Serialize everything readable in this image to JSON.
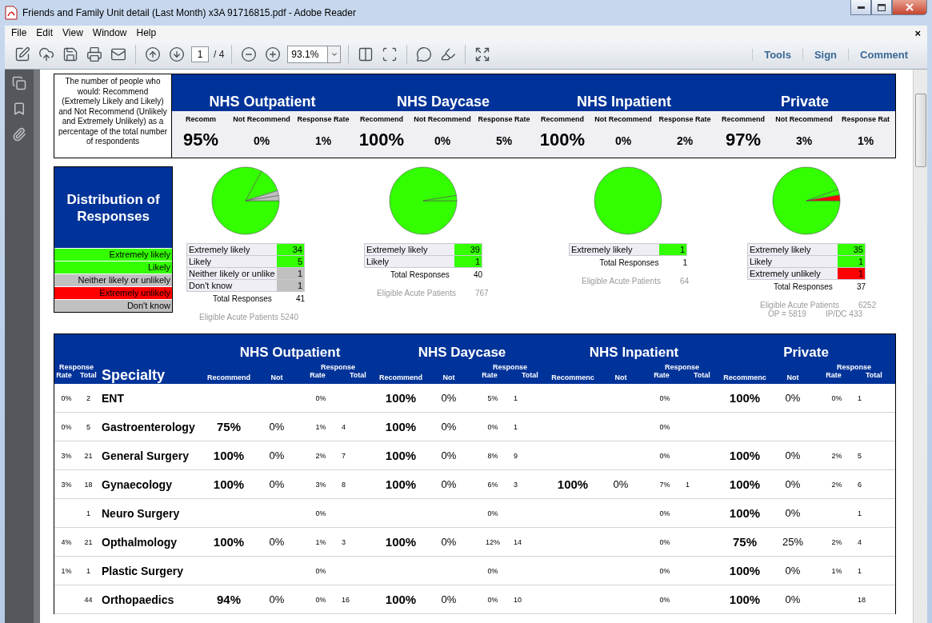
{
  "window": {
    "title": "Friends and Family Unit detail (Last Month) x3A 91716815.pdf - Adobe Reader"
  },
  "menu": [
    "File",
    "Edit",
    "View",
    "Window",
    "Help"
  ],
  "menu_close": "×",
  "toolbar": {
    "page": "1",
    "page_count": "/ 4",
    "zoom": "93.1%",
    "links": [
      "Tools",
      "Sign",
      "Comment"
    ]
  },
  "summary": {
    "description": "The number of people who would: Recommend (Extremely Likely and Likely) and Not Recommend (Unlikely and Extremely Unlikely) as a percentage of the total number of respondents",
    "sections": [
      {
        "title": "NHS Outpatient",
        "headers": [
          "Recomm",
          "Not Recommend",
          "Response Rate"
        ],
        "values": [
          "95%",
          "0%",
          "1%"
        ]
      },
      {
        "title": "NHS Daycase",
        "headers": [
          "Recommend",
          "Not Recommend",
          "Response Rate"
        ],
        "values": [
          "100%",
          "0%",
          "5%"
        ]
      },
      {
        "title": "NHS Inpatient",
        "headers": [
          "Recommend",
          "Not Recommend",
          "Response Rate"
        ],
        "values": [
          "100%",
          "0%",
          "2%"
        ]
      },
      {
        "title": "Private",
        "headers": [
          "Recommend",
          "Not Recommend",
          "Response Rat"
        ],
        "values": [
          "97%",
          "3%",
          "1%"
        ]
      }
    ]
  },
  "distribution": {
    "title": "Distribution of Responses",
    "legend": [
      {
        "label": "Extremely likely",
        "color": "#33ff00"
      },
      {
        "label": "Likely",
        "color": "#33ff00"
      },
      {
        "label": "Neither likely or unlikely",
        "color": "#c0c0c0"
      },
      {
        "label": "Extremely unlikely",
        "color": "#ff0000"
      },
      {
        "label": "Don't know",
        "color": "#c0c0c0"
      }
    ],
    "panels": [
      {
        "rows": [
          {
            "label": "Extremely likely",
            "count": "34",
            "color": "#33ff00"
          },
          {
            "label": "Likely",
            "count": "5",
            "color": "#33ff00"
          },
          {
            "label": "Neither likely or unlike",
            "count": "1",
            "color": "#c0c0c0"
          },
          {
            "label": "Don't know",
            "count": "1",
            "color": "#c0c0c0"
          }
        ],
        "total_label": "Total Responses",
        "total": "41",
        "eligible": [
          [
            "Eligible Acute Patients 5240"
          ]
        ]
      },
      {
        "rows": [
          {
            "label": "Extremely likely",
            "count": "39",
            "color": "#33ff00"
          },
          {
            "label": "Likely",
            "count": "1",
            "color": "#33ff00"
          }
        ],
        "total_label": "Total Responses",
        "total": "40",
        "eligible": [
          [
            "Eligible Acute Patients",
            "767"
          ]
        ]
      },
      {
        "rows": [
          {
            "label": "Extremely likely",
            "count": "1",
            "color": "#33ff00"
          }
        ],
        "total_label": "Total Responses",
        "total": "1",
        "eligible": [
          [
            "Eligible Acute Patients",
            "64"
          ]
        ]
      },
      {
        "rows": [
          {
            "label": "Extremely likely",
            "count": "35",
            "color": "#33ff00"
          },
          {
            "label": "Likely",
            "count": "1",
            "color": "#33ff00"
          },
          {
            "label": "Extremely unlikely",
            "count": "1",
            "color": "#ff0000"
          }
        ],
        "total_label": "Total Responses",
        "total": "37",
        "eligible": [
          [
            "Eligible Acute Patients",
            "6252"
          ],
          [
            "OP = 5819",
            "IP/DC 433"
          ]
        ]
      }
    ]
  },
  "table": {
    "left_headers": {
      "response": "Response",
      "rate": "Rate",
      "total": "Total",
      "specialty": "Specialty"
    },
    "sections": [
      {
        "title": "NHS Outpatient",
        "recommend": "Recommend",
        "not": "Not",
        "response": "Response",
        "rate": "Rate",
        "total": "Total"
      },
      {
        "title": "NHS Daycase",
        "recommend": "Recommend",
        "not": "Not",
        "response": "Response",
        "rate": "Rate",
        "total": "Total"
      },
      {
        "title": "NHS Inpatient",
        "recommend": "Recommenc",
        "not": "Not",
        "response": "Response",
        "rate": "Rate",
        "total": "Total"
      },
      {
        "title": "Private",
        "recommend": "Recommenc",
        "not": "Not",
        "response": "Response",
        "rate": "Rate",
        "total": "Total"
      }
    ],
    "rows": [
      {
        "rate": "0%",
        "total": "2",
        "specialty": "ENT",
        "cells": [
          {
            "rate": "0%"
          },
          {
            "recommend": "100%",
            "not": "0%",
            "rate": "5%",
            "total": "1"
          },
          {
            "rate": "0%"
          },
          {
            "recommend": "100%",
            "not": "0%",
            "rate": "0%",
            "total": "1"
          }
        ]
      },
      {
        "rate": "0%",
        "total": "5",
        "specialty": "Gastroenterology",
        "cells": [
          {
            "recommend": "75%",
            "not": "0%",
            "rate": "1%",
            "total": "4"
          },
          {
            "recommend": "100%",
            "not": "0%",
            "rate": "0%",
            "total": "1"
          },
          {
            "rate": "0%"
          },
          {}
        ]
      },
      {
        "rate": "3%",
        "total": "21",
        "specialty": "General Surgery",
        "cells": [
          {
            "recommend": "100%",
            "not": "0%",
            "rate": "2%",
            "total": "7"
          },
          {
            "recommend": "100%",
            "not": "0%",
            "rate": "8%",
            "total": "9"
          },
          {
            "rate": "0%"
          },
          {
            "recommend": "100%",
            "not": "0%",
            "rate": "2%",
            "total": "5"
          }
        ]
      },
      {
        "rate": "3%",
        "total": "18",
        "specialty": "Gynaecology",
        "cells": [
          {
            "recommend": "100%",
            "not": "0%",
            "rate": "3%",
            "total": "8"
          },
          {
            "recommend": "100%",
            "not": "0%",
            "rate": "6%",
            "total": "3"
          },
          {
            "recommend": "100%",
            "not": "0%",
            "rate": "7%",
            "total": "1"
          },
          {
            "recommend": "100%",
            "not": "0%",
            "rate": "2%",
            "total": "6"
          }
        ]
      },
      {
        "total": "1",
        "specialty": "Neuro Surgery",
        "cells": [
          {
            "rate": "0%"
          },
          {
            "rate": "0%"
          },
          {
            "rate": "0%"
          },
          {
            "recommend": "100%",
            "not": "0%",
            "total": "1"
          }
        ]
      },
      {
        "rate": "4%",
        "total": "21",
        "specialty": "Opthalmology",
        "cells": [
          {
            "recommend": "100%",
            "not": "0%",
            "rate": "1%",
            "total": "3"
          },
          {
            "recommend": "100%",
            "not": "0%",
            "rate": "12%",
            "total": "14"
          },
          {
            "rate": "0%"
          },
          {
            "recommend": "75%",
            "not": "25%",
            "rate": "2%",
            "total": "4"
          }
        ]
      },
      {
        "rate": "1%",
        "total": "1",
        "specialty": "Plastic Surgery",
        "cells": [
          {
            "rate": "0%"
          },
          {
            "rate": "0%"
          },
          {
            "rate": "0%"
          },
          {
            "recommend": "100%",
            "not": "0%",
            "rate": "1%",
            "total": "1"
          }
        ]
      },
      {
        "total": "44",
        "specialty": "Orthopaedics",
        "cells": [
          {
            "recommend": "94%",
            "not": "0%",
            "rate": "0%",
            "total": "16"
          },
          {
            "recommend": "100%",
            "not": "0%",
            "rate": "0%",
            "total": "10"
          },
          {
            "rate": "0%"
          },
          {
            "recommend": "100%",
            "not": "0%",
            "total": "18"
          }
        ]
      }
    ]
  }
}
